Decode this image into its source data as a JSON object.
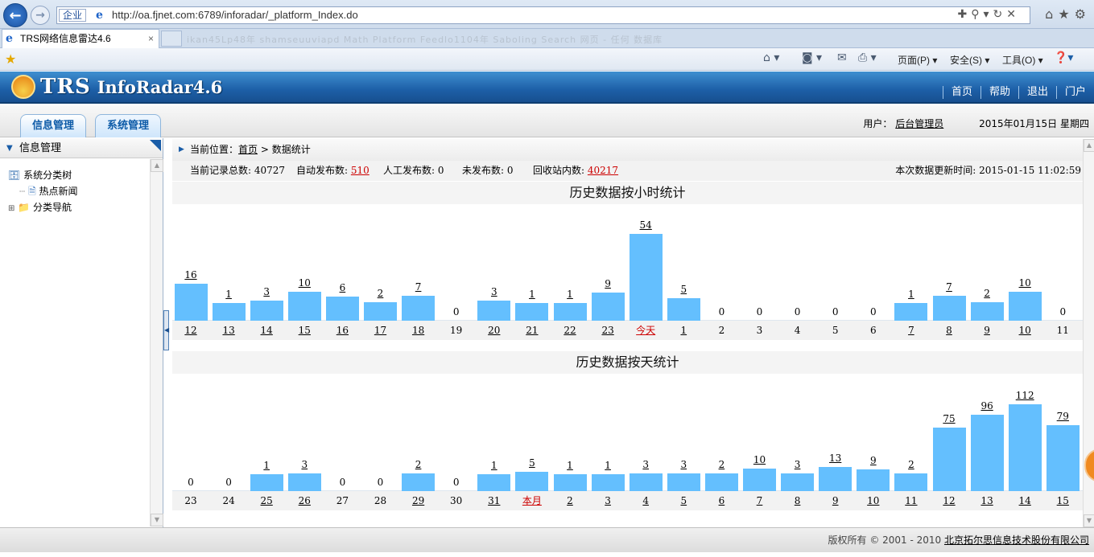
{
  "browser": {
    "zone_label": "企业",
    "url": "http://oa.fjnet.com:6789/inforadar/_platform_Index.do",
    "tab_title": "TRS网络信息雷达4.6",
    "tab_close": "×",
    "blurred_tabs": "ikan45Lp48年 shamseuuviapd Math Platform Feedlo1104年 Saboling Search 网页 - 任何 数据库",
    "cmd_page": "页面(P)",
    "cmd_safety": "安全(S)",
    "cmd_tools": "工具(O)"
  },
  "app": {
    "logo_brand": "TRS",
    "logo_product": "InfoRadar4.6",
    "topnav": [
      "首页",
      "帮助",
      "退出",
      "门户"
    ],
    "menu_tabs": [
      "信息管理",
      "系统管理"
    ],
    "user_label": "用户：",
    "user_name": "后台管理员",
    "date": "2015年01月15日  星期四"
  },
  "sidebar": {
    "title": "信息管理",
    "tree": [
      {
        "label": "系统分类树",
        "level": 0,
        "icon": "db-icon"
      },
      {
        "label": "热点新闻",
        "level": 1,
        "icon": "doc-icon"
      },
      {
        "label": "分类导航",
        "level": 0,
        "icon": "folder-icon"
      }
    ]
  },
  "breadcrumb": {
    "prefix": "当前位置：",
    "home": "首页",
    "sep": " > ",
    "current": "数据统计"
  },
  "stats": {
    "total_label": "当前记录总数:",
    "total": "40727",
    "auto_label": "自动发布数:",
    "auto": "510",
    "manual_label": "人工发布数:",
    "manual": "0",
    "unpub_label": "未发布数:",
    "unpub": "0",
    "recycle_label": "回收站内数:",
    "recycle": "40217",
    "update_label": "本次数据更新时间:",
    "update_time": "2015-01-15 11:02:59"
  },
  "chart_data": [
    {
      "type": "bar",
      "title": "历史数据按小时统计",
      "categories": [
        "12",
        "13",
        "14",
        "15",
        "16",
        "17",
        "18",
        "19",
        "20",
        "21",
        "22",
        "23",
        "今天",
        "1",
        "2",
        "3",
        "4",
        "5",
        "6",
        "7",
        "8",
        "9",
        "10",
        "11"
      ],
      "values": [
        16,
        1,
        3,
        10,
        6,
        2,
        7,
        0,
        3,
        1,
        1,
        9,
        54,
        5,
        0,
        0,
        0,
        0,
        0,
        1,
        7,
        2,
        10,
        0
      ],
      "highlight_color": "#cc0000"
    },
    {
      "type": "bar",
      "title": "历史数据按天统计",
      "categories": [
        "23",
        "24",
        "25",
        "26",
        "27",
        "28",
        "29",
        "30",
        "31",
        "本月",
        "2",
        "3",
        "4",
        "5",
        "6",
        "7",
        "8",
        "9",
        "10",
        "11",
        "12",
        "13",
        "14",
        "15"
      ],
      "values": [
        0,
        0,
        1,
        3,
        0,
        0,
        2,
        0,
        1,
        5,
        1,
        1,
        3,
        3,
        2,
        10,
        3,
        13,
        9,
        2,
        75,
        96,
        112,
        79
      ],
      "highlight_color": "#cc0000"
    }
  ],
  "footer": {
    "copyright": "版权所有 © 2001 - 2010 ",
    "company": "北京拓尔思信息技术股份有限公司"
  },
  "colors": {
    "bar": "#64bffe",
    "header_blue": "#1d5fa7",
    "link_red": "#cc0000"
  }
}
